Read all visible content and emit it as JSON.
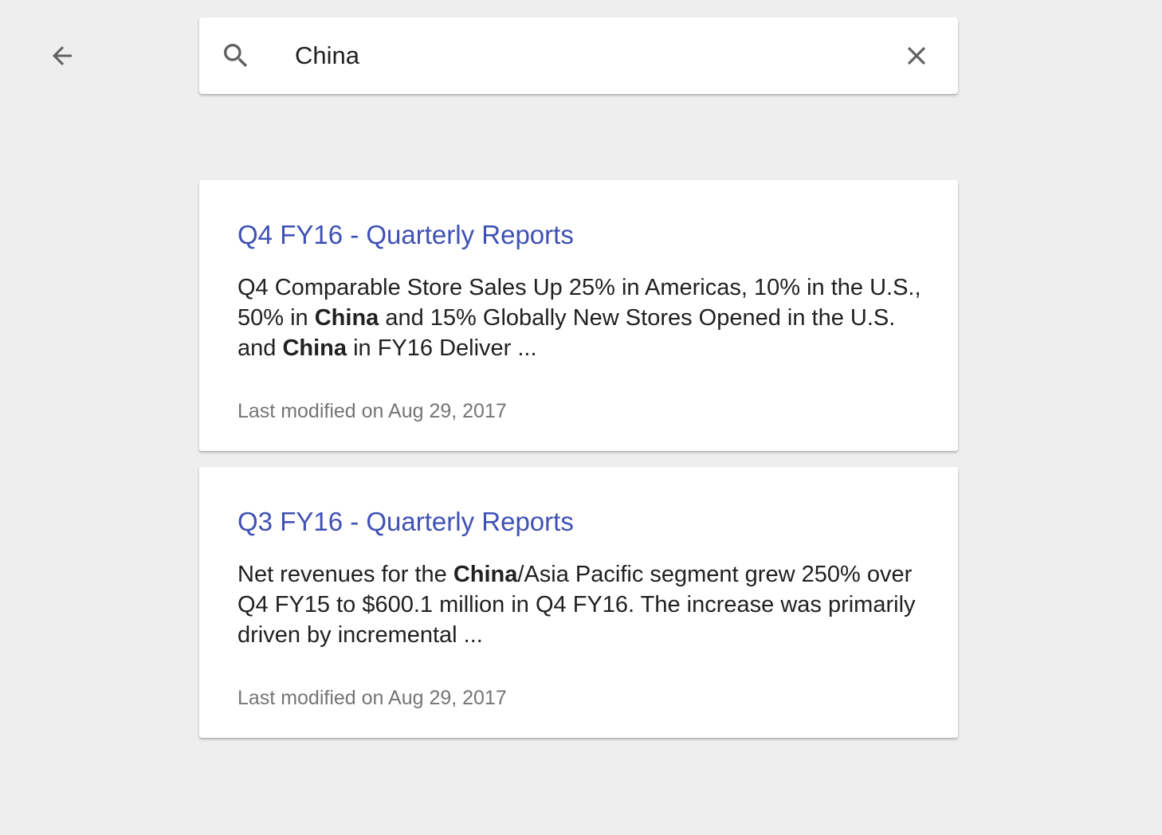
{
  "colors": {
    "background": "#eeeeee",
    "card": "#ffffff",
    "link": "#3f51b5",
    "text": "#212121",
    "muted": "#757575",
    "icon": "#616161"
  },
  "header": {
    "back_icon": "arrow-back-icon"
  },
  "search": {
    "icon": "search-icon",
    "value": "China",
    "clear_icon": "close-icon"
  },
  "results": [
    {
      "title": "Q4 FY16 - Quarterly Reports",
      "snippet": [
        {
          "text": "Q4 Comparable Store Sales Up 25% in Americas, 10% in the U.S., 50% in ",
          "bold": false
        },
        {
          "text": "China",
          "bold": true
        },
        {
          "text": " and 15% Globally New Stores Opened in the U.S. and ",
          "bold": false
        },
        {
          "text": "China",
          "bold": true
        },
        {
          "text": " in FY16 Deliver ...",
          "bold": false
        }
      ],
      "modified": "Last modified on Aug 29, 2017"
    },
    {
      "title": "Q3 FY16 - Quarterly Reports",
      "snippet": [
        {
          "text": "Net revenues for the ",
          "bold": false
        },
        {
          "text": "China",
          "bold": true
        },
        {
          "text": "/Asia Pacific segment grew 250% over Q4 FY15 to $600.1 million in Q4 FY16. The increase was primarily driven by incremental ...",
          "bold": false
        }
      ],
      "modified": "Last modified on Aug 29, 2017"
    }
  ]
}
